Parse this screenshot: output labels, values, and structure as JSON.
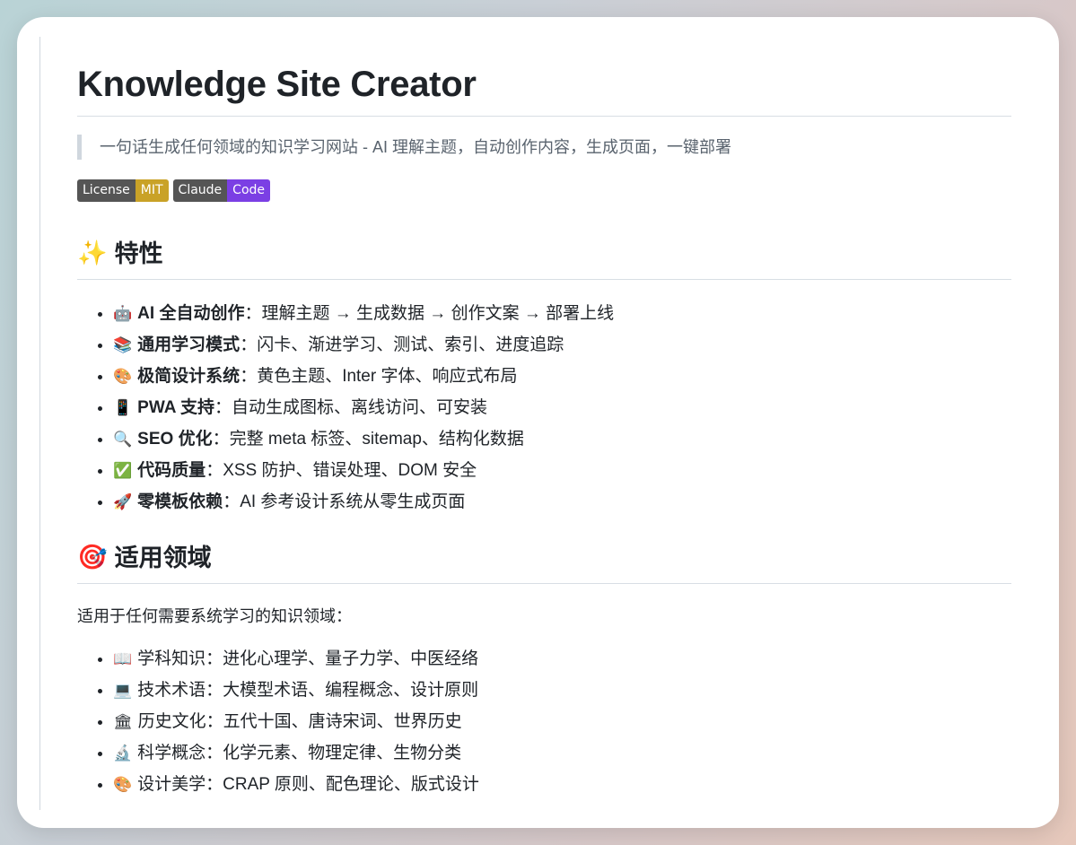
{
  "title": "Knowledge Site Creator",
  "tagline": "一句话生成任何领域的知识学习网站 - AI 理解主题，自动创作内容，生成页面，一键部署",
  "badges": [
    {
      "key": "License",
      "value": "MIT",
      "color": "#c9a227"
    },
    {
      "key": "Claude",
      "value": "Code",
      "color": "#7b3fe4"
    }
  ],
  "features": {
    "heading_icon": "✨",
    "heading": "特性",
    "items": [
      {
        "icon": "🤖",
        "label": "AI 全自动创作",
        "text": "：理解主题 → 生成数据 → 创作文案 → 部署上线"
      },
      {
        "icon": "📚",
        "label": "通用学习模式",
        "text": "：闪卡、渐进学习、测试、索引、进度追踪"
      },
      {
        "icon": "🎨",
        "label": "极简设计系统",
        "text": "：黄色主题、Inter 字体、响应式布局"
      },
      {
        "icon": "📱",
        "label": "PWA 支持",
        "text": "：自动生成图标、离线访问、可安装"
      },
      {
        "icon": "🔍",
        "label": "SEO 优化",
        "text": "：完整 meta 标签、sitemap、结构化数据"
      },
      {
        "icon": "✅",
        "label": "代码质量",
        "text": "：XSS 防护、错误处理、DOM 安全"
      },
      {
        "icon": "🚀",
        "label": "零模板依赖",
        "text": "：AI 参考设计系统从零生成页面"
      }
    ]
  },
  "domains": {
    "heading_icon": "🎯",
    "heading": "适用领域",
    "intro": "适用于任何需要系统学习的知识领域：",
    "items": [
      {
        "icon": "📖",
        "text": "学科知识：进化心理学、量子力学、中医经络"
      },
      {
        "icon": "💻",
        "text": "技术术语：大模型术语、编程概念、设计原则"
      },
      {
        "icon": "🏛",
        "text": "历史文化：五代十国、唐诗宋词、世界历史"
      },
      {
        "icon": "🔬",
        "text": "科学概念：化学元素、物理定律、生物分类"
      },
      {
        "icon": "🎨",
        "text": "设计美学：CRAP 原则、配色理论、版式设计"
      }
    ]
  }
}
